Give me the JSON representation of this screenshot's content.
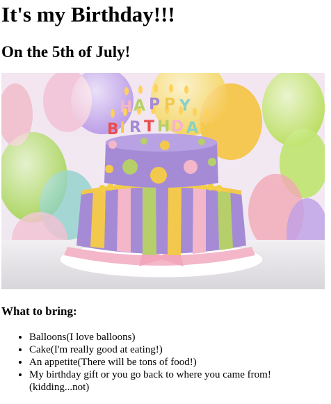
{
  "page": {
    "title": "It's my Birthday!!!",
    "subtitle": "On the 5th of July!",
    "cake_candles_text": "HAPPY BIRTHDAY",
    "bring_heading": "What to bring:",
    "bring_items": [
      "Balloons(I love balloons)",
      "Cake(I'm really good at eating!)",
      "An appetite(There will be tons of food!)",
      "My birthday gift or you go back to where you came from! (kidding...not)"
    ]
  },
  "colors": {
    "text": "#000000",
    "background": "#ffffff",
    "cake_purple": "#a58bd6",
    "cake_yellow": "#f2c94c",
    "cake_pink": "#f4b6c9",
    "cake_green": "#b6cf6a"
  }
}
